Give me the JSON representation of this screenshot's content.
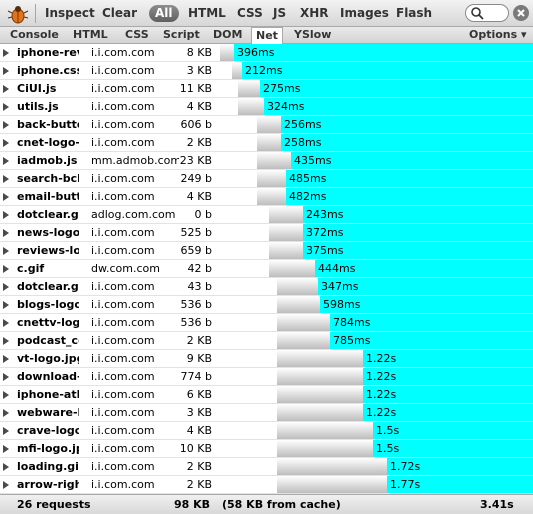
{
  "toolbar": {
    "items": [
      "Inspect",
      "Clear",
      "All",
      "HTML",
      "CSS",
      "JS",
      "XHR",
      "Images",
      "Flash"
    ],
    "selected": "All"
  },
  "tabs": {
    "items": [
      "Console",
      "HTML",
      "CSS",
      "Script",
      "DOM",
      "Net",
      "YSlow"
    ],
    "active": "Net",
    "options_label": "Options ▾"
  },
  "requests": [
    {
      "file": "iphone-rev",
      "domain": "i.i.com.com",
      "size": "8 KB",
      "time": "396ms",
      "wait": 0.3,
      "start": 0.0,
      "end": 1.0
    },
    {
      "file": "iphone.css",
      "domain": "i.i.com.com",
      "size": "3 KB",
      "time": "212ms",
      "wait": 0.2,
      "start": 0.095,
      "end": 1.0
    },
    {
      "file": "CiUI.js",
      "domain": "i.i.com.com",
      "size": "11 KB",
      "time": "275ms",
      "wait": 0.45,
      "start": 0.142,
      "end": 1.0
    },
    {
      "file": "utils.js",
      "domain": "i.i.com.com",
      "size": "4 KB",
      "time": "324ms",
      "wait": 0.55,
      "start": 0.142,
      "end": 1.0
    },
    {
      "file": "back-butto",
      "domain": "i.i.com.com",
      "size": "606 b",
      "time": "256ms",
      "wait": 0.5,
      "start": 0.296,
      "end": 1.0
    },
    {
      "file": "cnet-logo-",
      "domain": "i.i.com.com",
      "size": "2 KB",
      "time": "258ms",
      "wait": 0.5,
      "start": 0.296,
      "end": 1.0
    },
    {
      "file": "iadmob.js",
      "domain": "mm.admob.com",
      "size": "23 KB",
      "time": "435ms",
      "wait": 0.7,
      "start": 0.296,
      "end": 1.0
    },
    {
      "file": "search-bck",
      "domain": "i.i.com.com",
      "size": "249 b",
      "time": "485ms",
      "wait": 0.6,
      "start": 0.296,
      "end": 1.0
    },
    {
      "file": "email-butt",
      "domain": "i.i.com.com",
      "size": "4 KB",
      "time": "482ms",
      "wait": 0.6,
      "start": 0.296,
      "end": 1.0
    },
    {
      "file": "dotclear.gif",
      "domain": "adlog.com.com",
      "size": "0 b",
      "time": "243ms",
      "wait": 0.7,
      "start": 0.393,
      "end": 1.0
    },
    {
      "file": "news-logo.",
      "domain": "i.i.com.com",
      "size": "525 b",
      "time": "372ms",
      "wait": 0.7,
      "start": 0.393,
      "end": 1.0
    },
    {
      "file": "reviews-lo",
      "domain": "i.i.com.com",
      "size": "659 b",
      "time": "375ms",
      "wait": 0.7,
      "start": 0.393,
      "end": 1.0
    },
    {
      "file": "c.gif",
      "domain": "dw.com.com",
      "size": "42 b",
      "time": "444ms",
      "wait": 0.95,
      "start": 0.393,
      "end": 1.0
    },
    {
      "file": "dotclear.gif",
      "domain": "i.i.com.com",
      "size": "43 b",
      "time": "347ms",
      "wait": 0.85,
      "start": 0.452,
      "end": 1.0
    },
    {
      "file": "blogs-logo",
      "domain": "i.i.com.com",
      "size": "536 b",
      "time": "598ms",
      "wait": 0.9,
      "start": 0.452,
      "end": 1.0
    },
    {
      "file": "cnettv-logo",
      "domain": "i.i.com.com",
      "size": "536 b",
      "time": "784ms",
      "wait": 1.1,
      "start": 0.452,
      "end": 1.0
    },
    {
      "file": "podcast_ce",
      "domain": "i.i.com.com",
      "size": "2 KB",
      "time": "785ms",
      "wait": 1.1,
      "start": 0.452,
      "end": 1.0
    },
    {
      "file": "vt-logo.jpg",
      "domain": "i.i.com.com",
      "size": "9 KB",
      "time": "1.22s",
      "wait": 1.8,
      "start": 0.452,
      "end": 1.0
    },
    {
      "file": "download-",
      "domain": "i.i.com.com",
      "size": "774 b",
      "time": "1.22s",
      "wait": 1.8,
      "start": 0.452,
      "end": 1.0
    },
    {
      "file": "iphone-atla",
      "domain": "i.i.com.com",
      "size": "6 KB",
      "time": "1.22s",
      "wait": 1.8,
      "start": 0.452,
      "end": 1.0
    },
    {
      "file": "webware-lo",
      "domain": "i.i.com.com",
      "size": "3 KB",
      "time": "1.22s",
      "wait": 1.8,
      "start": 0.452,
      "end": 1.0
    },
    {
      "file": "crave-logo",
      "domain": "i.i.com.com",
      "size": "4 KB",
      "time": "1.5s",
      "wait": 2.0,
      "start": 0.452,
      "end": 1.0
    },
    {
      "file": "mfi-logo.jp",
      "domain": "i.i.com.com",
      "size": "10 KB",
      "time": "1.5s",
      "wait": 2.0,
      "start": 0.452,
      "end": 1.0
    },
    {
      "file": "loading.gif",
      "domain": "i.i.com.com",
      "size": "2 KB",
      "time": "1.72s",
      "wait": 2.3,
      "start": 0.452,
      "end": 1.0
    },
    {
      "file": "arrow-righ",
      "domain": "i.i.com.com",
      "size": "2 KB",
      "time": "1.77s",
      "wait": 2.3,
      "start": 0.452,
      "end": 1.0
    }
  ],
  "summary": {
    "requests": "26 requests",
    "total_size": "98 KB",
    "cache": "(58 KB from cache)",
    "total_time": "3.41s"
  },
  "colors": {
    "receiving": "#00ffff",
    "active_filter": "#6f6f6f"
  }
}
